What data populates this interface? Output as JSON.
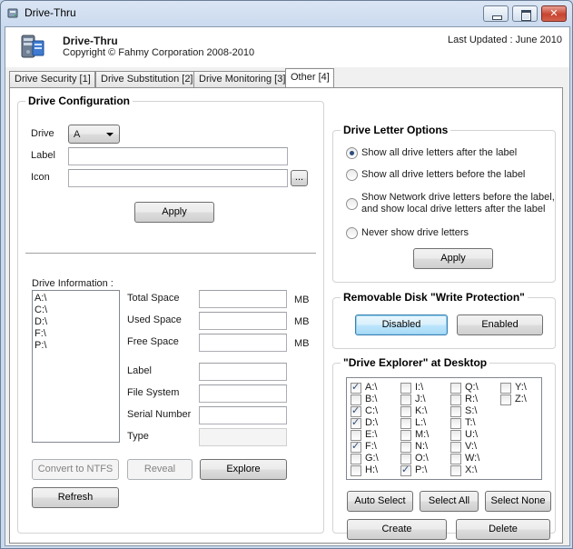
{
  "window": {
    "title": "Drive-Thru",
    "app_name": "Drive-Thru",
    "copyright": "Copyright © Fahmy Corporation 2008-2010",
    "last_updated": "Last Updated : June 2010"
  },
  "tabs": [
    {
      "label": "Drive Security [1]"
    },
    {
      "label": "Drive Substitution [2]"
    },
    {
      "label": "Drive Monitoring [3]"
    },
    {
      "label": "Other [4]"
    }
  ],
  "drive_config": {
    "title": "Drive Configuration",
    "drive_label": "Drive",
    "drive_value": "A",
    "label_label": "Label",
    "label_value": "",
    "icon_label": "Icon",
    "icon_value": "",
    "browse_label": "...",
    "apply_label": "Apply"
  },
  "drive_info": {
    "title": "Drive Information :",
    "drives": [
      "A:\\",
      "C:\\",
      "D:\\",
      "F:\\",
      "P:\\"
    ],
    "total_space_label": "Total Space",
    "used_space_label": "Used Space",
    "free_space_label": "Free Space",
    "unit": "MB",
    "label_label": "Label",
    "file_system_label": "File System",
    "serial_number_label": "Serial Number",
    "type_label": "Type",
    "convert_label": "Convert to NTFS",
    "reveal_label": "Reveal",
    "explore_label": "Explore",
    "refresh_label": "Refresh"
  },
  "letter_options": {
    "title": "Drive Letter Options",
    "options": [
      {
        "label": "Show all drive letters after the label",
        "selected": true
      },
      {
        "label": "Show all drive letters before the label",
        "selected": false
      },
      {
        "label1": "Show Network drive letters before the label,",
        "label2": "and show local drive letters after the label",
        "selected": false
      },
      {
        "label": "Never show drive letters",
        "selected": false
      }
    ],
    "apply_label": "Apply"
  },
  "removable": {
    "title": "Removable Disk \"Write Protection\"",
    "disabled_label": "Disabled",
    "enabled_label": "Enabled"
  },
  "explorer": {
    "title": "\"Drive Explorer\" at Desktop",
    "columns": [
      [
        {
          "label": "A:\\",
          "checked": true
        },
        {
          "label": "B:\\",
          "checked": false
        },
        {
          "label": "C:\\",
          "checked": true
        },
        {
          "label": "D:\\",
          "checked": true
        },
        {
          "label": "E:\\",
          "checked": false
        },
        {
          "label": "F:\\",
          "checked": true
        },
        {
          "label": "G:\\",
          "checked": false
        },
        {
          "label": "H:\\",
          "checked": false
        }
      ],
      [
        {
          "label": "I:\\",
          "checked": false
        },
        {
          "label": "J:\\",
          "checked": false
        },
        {
          "label": "K:\\",
          "checked": false
        },
        {
          "label": "L:\\",
          "checked": false
        },
        {
          "label": "M:\\",
          "checked": false
        },
        {
          "label": "N:\\",
          "checked": false
        },
        {
          "label": "O:\\",
          "checked": false
        },
        {
          "label": "P:\\",
          "checked": true
        }
      ],
      [
        {
          "label": "Q:\\",
          "checked": false
        },
        {
          "label": "R:\\",
          "checked": false
        },
        {
          "label": "S:\\",
          "checked": false
        },
        {
          "label": "T:\\",
          "checked": false
        },
        {
          "label": "U:\\",
          "checked": false
        },
        {
          "label": "V:\\",
          "checked": false
        },
        {
          "label": "W:\\",
          "checked": false
        },
        {
          "label": "X:\\",
          "checked": false
        }
      ],
      [
        {
          "label": "Y:\\",
          "checked": false
        },
        {
          "label": "Z:\\",
          "checked": false
        }
      ]
    ],
    "auto_select_label": "Auto Select",
    "select_all_label": "Select All",
    "select_none_label": "Select None",
    "create_label": "Create",
    "delete_label": "Delete"
  }
}
